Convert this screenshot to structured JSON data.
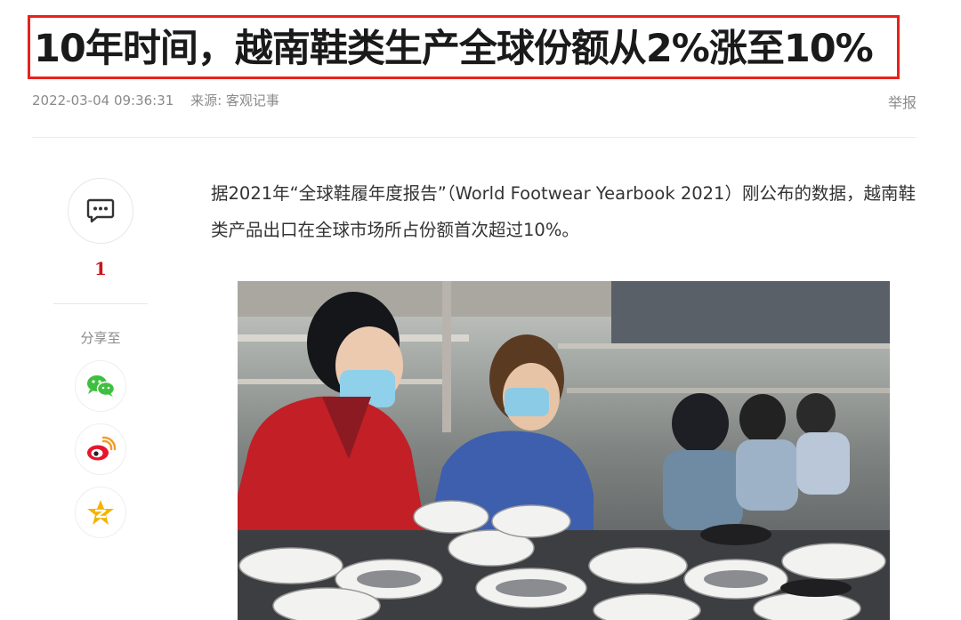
{
  "article": {
    "title": "10年时间，越南鞋类生产全球份额从2%涨至10%",
    "datetime": "2022-03-04 09:36:31",
    "source": "来源: 客观记事",
    "report_label": "举报",
    "lead_paragraph": "据2021年“全球鞋履年度报告”（World Footwear Yearbook 2021）刚公布的数据，越南鞋类产品出口在全球市场所占份额首次超过10%。"
  },
  "sidebar": {
    "comment_count": "1",
    "share_label": "分享至",
    "share_targets": [
      "wechat-icon",
      "weibo-icon",
      "qzone-icon"
    ]
  },
  "colors": {
    "title_border": "#e8221b",
    "comment_count": "#c9151e",
    "wechat": "#3fbf3f",
    "weibo": "#e6162d",
    "qzone": "#f5b400"
  }
}
